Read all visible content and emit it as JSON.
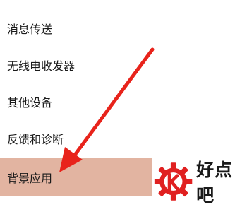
{
  "settings_menu": {
    "items": [
      {
        "label": "消息传送"
      },
      {
        "label": "无线电收发器"
      },
      {
        "label": "其他设备"
      },
      {
        "label": "反馈和诊断"
      },
      {
        "label": "背景应用",
        "highlighted": true
      }
    ],
    "highlight_color": "#e2b4a1"
  },
  "annotation": {
    "arrow_color": "#e8231b",
    "arrow_target": "背景应用"
  },
  "watermark": {
    "logo_icon": "gear-k-logo",
    "text": "好点吧",
    "color": "#e02020"
  }
}
